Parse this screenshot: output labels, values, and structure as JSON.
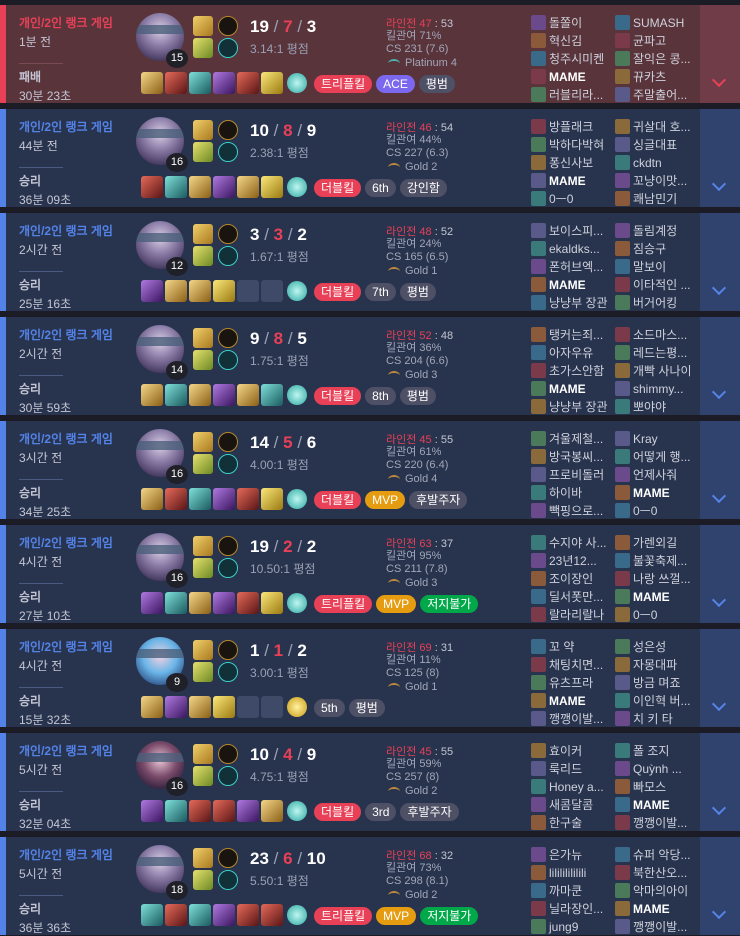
{
  "matches": [
    {
      "result_class": "loss",
      "queue": "개인/2인 랭크 게임",
      "ago": "1분 전",
      "result": "패배",
      "duration": "30분 23초",
      "champion": "Kayn",
      "level": "15",
      "kills": "19",
      "deaths": "7",
      "assists": "3",
      "ratio": "3.14:1 평점",
      "lane_label": "라인전 47",
      "lane_opp": " : 53",
      "kp": "킬관여 71%",
      "cs": "CS 231 (7.6)",
      "tier": "Platinum 4",
      "tier_icon": "platinum",
      "items": [
        "gold",
        "red",
        "teal",
        "purple",
        "red",
        "yellow"
      ],
      "ward": "teal",
      "badges": [
        {
          "text": "트리플킬",
          "style": "red"
        },
        {
          "text": "ACE",
          "style": "ace"
        },
        {
          "text": "평범",
          "style": "gray"
        }
      ],
      "team1": [
        "돌쫄이",
        "혁신김",
        "청주시미켄",
        "MAME",
        "러블리라..."
      ],
      "team2": [
        "SUMASH",
        "균파고",
        "잘익은 콩...",
        "뀨카츠",
        "주말출어..."
      ]
    },
    {
      "result_class": "win",
      "queue": "개인/2인 랭크 게임",
      "ago": "44분 전",
      "result": "승리",
      "duration": "36분 09초",
      "champion": "Kayn",
      "level": "16",
      "kills": "10",
      "deaths": "8",
      "assists": "9",
      "ratio": "2.38:1 평점",
      "lane_label": "라인전 46",
      "lane_opp": " : 54",
      "kp": "킬관여 44%",
      "cs": "CS 227 (6.3)",
      "tier": "Gold 2",
      "tier_icon": "gold",
      "items": [
        "red",
        "teal",
        "gold",
        "purple",
        "gold",
        "yellow"
      ],
      "ward": "teal",
      "badges": [
        {
          "text": "더블킬",
          "style": "red"
        },
        {
          "text": "6th",
          "style": "gray"
        },
        {
          "text": "강인함",
          "style": "gray"
        }
      ],
      "team1": [
        "방플래크",
        "박하다박혀",
        "퐁신사보",
        "MAME",
        "0ㅡ0"
      ],
      "team2": [
        "귀살대 호...",
        "싱글대표",
        "ckdtn",
        "꼬냥이맛...",
        "쾌남민기"
      ]
    },
    {
      "result_class": "win",
      "queue": "개인/2인 랭크 게임",
      "ago": "2시간 전",
      "result": "승리",
      "duration": "25분 16초",
      "champion": "Kayn",
      "level": "12",
      "kills": "3",
      "deaths": "3",
      "assists": "2",
      "ratio": "1.67:1 평점",
      "lane_label": "라인전 48",
      "lane_opp": " : 52",
      "kp": "킬관여 24%",
      "cs": "CS 165 (6.5)",
      "tier": "Gold 1",
      "tier_icon": "gold",
      "items": [
        "purple",
        "gold",
        "gold",
        "yellow",
        "empty",
        "empty"
      ],
      "ward": "teal",
      "badges": [
        {
          "text": "더블킬",
          "style": "red"
        },
        {
          "text": "7th",
          "style": "gray"
        },
        {
          "text": "평범",
          "style": "gray"
        }
      ],
      "team1": [
        "보이스피...",
        "ekaldks...",
        "폰허브엑...",
        "MAME",
        "냥냥부 장관"
      ],
      "team2": [
        "돌림계정",
        "짐승구",
        "말보이",
        "이타적인 ...",
        "버거어킹"
      ]
    },
    {
      "result_class": "win",
      "queue": "개인/2인 랭크 게임",
      "ago": "2시간 전",
      "result": "승리",
      "duration": "30분 59초",
      "champion": "Kayn",
      "level": "14",
      "kills": "9",
      "deaths": "8",
      "assists": "5",
      "ratio": "1.75:1 평점",
      "lane_label": "라인전 52",
      "lane_opp": " : 48",
      "kp": "킬관여 36%",
      "cs": "CS 204 (6.6)",
      "tier": "Gold 3",
      "tier_icon": "gold",
      "items": [
        "gold",
        "teal",
        "gold",
        "purple",
        "gold",
        "teal"
      ],
      "ward": "teal",
      "badges": [
        {
          "text": "더블킬",
          "style": "red"
        },
        {
          "text": "8th",
          "style": "gray"
        },
        {
          "text": "평범",
          "style": "gray"
        }
      ],
      "team1": [
        "탱커는죄...",
        "아자우유",
        "초가스안함",
        "MAME",
        "냥냥부 장관"
      ],
      "team2": [
        "소드마스...",
        "레드는평...",
        "개빡 사나이",
        "shimmy...",
        "뽀야야"
      ]
    },
    {
      "result_class": "win",
      "queue": "개인/2인 랭크 게임",
      "ago": "3시간 전",
      "result": "승리",
      "duration": "34분 25초",
      "champion": "Kayn",
      "level": "16",
      "kills": "14",
      "deaths": "5",
      "assists": "6",
      "ratio": "4.00:1 평점",
      "lane_label": "라인전 45",
      "lane_opp": " : 55",
      "kp": "킬관여 61%",
      "cs": "CS 220 (6.4)",
      "tier": "Gold 4",
      "tier_icon": "gold",
      "items": [
        "gold",
        "red",
        "teal",
        "purple",
        "red",
        "yellow"
      ],
      "ward": "teal",
      "badges": [
        {
          "text": "더블킬",
          "style": "red"
        },
        {
          "text": "MVP",
          "style": "gold"
        },
        {
          "text": "후발주자",
          "style": "gray"
        }
      ],
      "team1": [
        "겨울제철...",
        "방국봉씨...",
        "프로비돌러",
        "하이바",
        "빽핑으로..."
      ],
      "team2": [
        "Kray",
        "어떻게 행...",
        "언제사줘",
        "MAME",
        "0ㅡ0"
      ]
    },
    {
      "result_class": "win",
      "queue": "개인/2인 랭크 게임",
      "ago": "4시간 전",
      "result": "승리",
      "duration": "27분 10초",
      "champion": "Kayn",
      "level": "16",
      "kills": "19",
      "deaths": "2",
      "assists": "2",
      "ratio": "10.50:1 평점",
      "lane_label": "라인전 63",
      "lane_opp": " : 37",
      "kp": "킬관여 95%",
      "cs": "CS 211 (7.8)",
      "tier": "Gold 3",
      "tier_icon": "gold",
      "items": [
        "purple",
        "teal",
        "gold",
        "purple",
        "red",
        "yellow"
      ],
      "ward": "teal",
      "badges": [
        {
          "text": "트리플킬",
          "style": "red"
        },
        {
          "text": "MVP",
          "style": "gold"
        },
        {
          "text": "저지불가",
          "style": "green"
        }
      ],
      "team1": [
        "수지야 사...",
        "23년12...",
        "조이장인",
        "딜서폿만...",
        "랄라리랄나"
      ],
      "team2": [
        "가렌외길",
        "불꽃축제...",
        "나랑 쓰껄...",
        "MAME",
        "0ㅡ0"
      ]
    },
    {
      "result_class": "win",
      "queue": "개인/2인 랭크 게임",
      "ago": "4시간 전",
      "result": "승리",
      "duration": "15분 32초",
      "champion": "Jinx",
      "level": "9",
      "kills": "1",
      "deaths": "1",
      "assists": "2",
      "ratio": "3.00:1 평점",
      "lane_label": "라인전 69",
      "lane_opp": " : 31",
      "kp": "킬관여 11%",
      "cs": "CS 125 (8)",
      "tier": "Gold 1",
      "tier_icon": "gold",
      "items": [
        "gold",
        "purple",
        "gold",
        "yellow",
        "empty",
        "empty"
      ],
      "ward": "yellow",
      "badges": [
        {
          "text": "5th",
          "style": "gray"
        },
        {
          "text": "평범",
          "style": "gray"
        }
      ],
      "team1": [
        "꼬 약",
        "채팅치면...",
        "유츠프라",
        "MAME",
        "깽깽이발..."
      ],
      "team2": [
        "성은성",
        "자몽대파",
        "방금 며죠",
        "이인혁 버...",
        "치 키 타"
      ]
    },
    {
      "result_class": "win",
      "queue": "개인/2인 랭크 게임",
      "ago": "5시간 전",
      "result": "승리",
      "duration": "32분 04초",
      "champion": "Kai'Sa",
      "level": "16",
      "kills": "10",
      "deaths": "4",
      "assists": "9",
      "ratio": "4.75:1 평점",
      "lane_label": "라인전 45",
      "lane_opp": " : 55",
      "kp": "킬관여 59%",
      "cs": "CS 257 (8)",
      "tier": "Gold 2",
      "tier_icon": "gold",
      "items": [
        "purple",
        "teal",
        "red",
        "red",
        "purple",
        "gold"
      ],
      "ward": "teal",
      "badges": [
        {
          "text": "더블킬",
          "style": "red"
        },
        {
          "text": "3rd",
          "style": "gray"
        },
        {
          "text": "후발주자",
          "style": "gray"
        }
      ],
      "team1": [
        "효이커",
        "룩리드",
        "Honey a...",
        "새콤달콤",
        "한구술"
      ],
      "team2": [
        "폴 조지",
        "Quỳnh ...",
        "빠모스",
        "MAME",
        "깽깽이발..."
      ]
    },
    {
      "result_class": "win",
      "queue": "개인/2인 랭크 게임",
      "ago": "5시간 전",
      "result": "승리",
      "duration": "36분 36초",
      "champion": "Kayn",
      "level": "18",
      "kills": "23",
      "deaths": "6",
      "assists": "10",
      "ratio": "5.50:1 평점",
      "lane_label": "라인전 68",
      "lane_opp": " : 32",
      "kp": "킬관여 73%",
      "cs": "CS 298 (8.1)",
      "tier": "Gold 2",
      "tier_icon": "gold",
      "items": [
        "teal",
        "red",
        "teal",
        "purple",
        "red",
        "red"
      ],
      "ward": "teal",
      "badges": [
        {
          "text": "트리플킬",
          "style": "red"
        },
        {
          "text": "MVP",
          "style": "gold"
        },
        {
          "text": "저지불가",
          "style": "green"
        }
      ],
      "team1": [
        "은가뉴",
        "lilililililili",
        "까마쿤",
        "닐라장인...",
        "jung9"
      ],
      "team2": [
        "슈퍼 악당...",
        "북한산오...",
        "악마의아이",
        "MAME",
        "깽깽이발..."
      ]
    }
  ],
  "colors": {
    "win": "#5383e8",
    "loss": "#e84057"
  }
}
